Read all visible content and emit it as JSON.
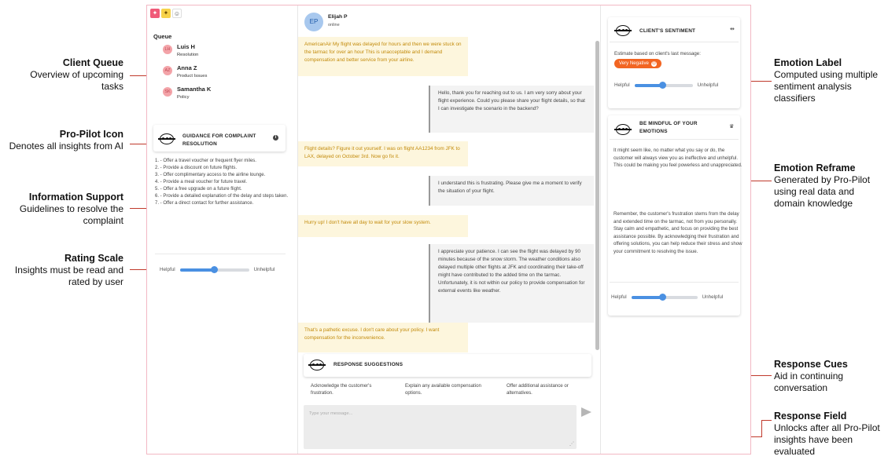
{
  "annotations": {
    "client_queue": {
      "title": "Client Queue",
      "desc": "Overview of upcoming tasks"
    },
    "pro_pilot_icon": {
      "title": "Pro-Pilot Icon",
      "desc": "Denotes all insights from AI"
    },
    "information_support": {
      "title": "Information Support",
      "desc": "Guidelines to resolve the complaint"
    },
    "rating_scale": {
      "title": "Rating Scale",
      "desc": "Insights must be read and rated by user"
    },
    "emotion_label": {
      "title": "Emotion Label",
      "desc": "Computed using multiple sentiment analysis classifiers"
    },
    "emotion_reframe": {
      "title": "Emotion Reframe",
      "desc": "Generated by Pro-Pilot using real data and domain knowledge"
    },
    "response_cues": {
      "title": "Response Cues",
      "desc": "Aid in continuing conversation"
    },
    "response_field": {
      "title": "Response Field",
      "desc": "Unlocks after all Pro-Pilot insights have been evaluated"
    }
  },
  "colors": {
    "accent": "#4a90e2",
    "customer_bubble": "#fdf6dd",
    "customer_text": "#c28a0a",
    "negative_badge": "#f26522",
    "annotation_line": "#c0392b",
    "frame_border": "#f2b8c4"
  },
  "queue": {
    "title": "Queue",
    "items": [
      {
        "initials": "LH",
        "name": "Luis H",
        "topic": "Resolution"
      },
      {
        "initials": "AZ",
        "name": "Anna Z",
        "topic": "Product Issues"
      },
      {
        "initials": "SK",
        "name": "Samantha K",
        "topic": "Policy"
      }
    ]
  },
  "guidance": {
    "title": "GUIDANCE FOR COMPLAINT RESOLUTION",
    "items": [
      "1. - Offer a travel voucher or frequent flyer miles.",
      "2. - Provide a discount on future flights.",
      "3. - Offer complimentary access to the airline lounge.",
      "4. - Provide a meal voucher for future travel.",
      "5. - Offer a free upgrade on a future flight.",
      "6. - Provide a detailed explanation of the delay and steps taken.",
      "7. - Offer a direct contact for further assistance."
    ]
  },
  "rating": {
    "helpful": "Helpful",
    "unhelpful": "Unhelpful",
    "left_value": 0.5,
    "sentiment_value": 0.48,
    "emotions_value": 0.48
  },
  "chat": {
    "contact_initials": "EP",
    "contact_name": "Elijah P",
    "status": "online",
    "messages": [
      {
        "from": "customer",
        "text": "AmericanAir My flight was delayed for hours and then we were stuck on the tarmac for over an hour This is unacceptable and I demand compensation and better service from your airline."
      },
      {
        "from": "agent",
        "text": "Hello, thank you for reaching out to us. I am very sorry about your flight experience. Could you please share your flight details, so that I can investigate the scenario in the backend?"
      },
      {
        "from": "customer",
        "text": "Flight details? Figure it out yourself. I was on flight AA1234 from JFK to LAX, delayed on October 3rd. Now go fix it."
      },
      {
        "from": "agent",
        "text": "I understand this is frustrating. Please give me a moment to verify the situation of your flight."
      },
      {
        "from": "customer",
        "text": "Hurry up! I don't have all day to wait for your slow system."
      },
      {
        "from": "agent",
        "text": "I appreciate your patience. I can see the flight was delayed by 90 minutes because of the snow storm. The weather conditions also delayed multiple other flights at JFK and coordinating their take-off might have contributed to the added time on the tarmac. Unfortunately, it is not within our policy to provide compensation for external events like weather."
      },
      {
        "from": "customer",
        "text": "That's a pathetic excuse. I don't care about your policy. I want compensation for the inconvenience."
      }
    ]
  },
  "suggestions": {
    "title": "RESPONSE SUGGESTIONS",
    "items": [
      "Acknowledge the customer's frustration.",
      "Explain any available compensation options.",
      "Offer additional assistance or alternatives."
    ]
  },
  "composer": {
    "placeholder": "Type your message..."
  },
  "sentiment": {
    "title": "CLIENT'S SENTIMENT",
    "estimate_label": "Estimate based on client's last message:",
    "badge": "Very Negative"
  },
  "emotions": {
    "title": "BE MINDFUL OF YOUR EMOTIONS",
    "para1": "It might seem like, no matter what you say or do, the customer will always view you as ineffective and unhelpful. This could be making you feel powerless and unappreciated.",
    "para2": "Remember, the customer's frustration stems from the delay and extended time on the tarmac, not from you personally. Stay calm and empathetic, and focus on providing the best assistance possible. By acknowledging their frustration and offering solutions, you can help reduce their stress and show your commitment to resolving the issue."
  }
}
